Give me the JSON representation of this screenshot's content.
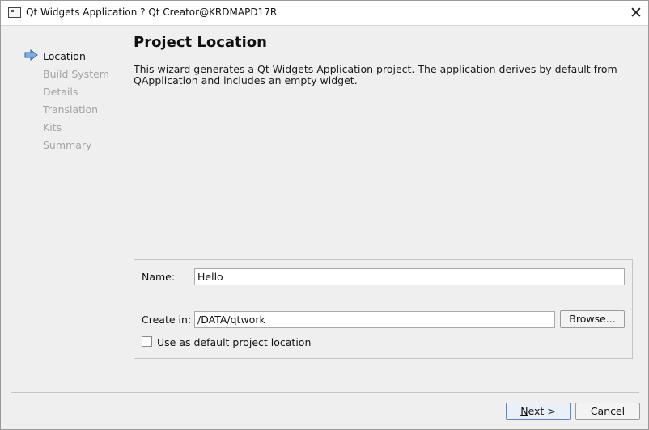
{
  "window": {
    "title": "Qt Widgets Application ? Qt Creator@KRDMAPD17R",
    "close_icon": "close-icon"
  },
  "sidebar": {
    "steps": [
      {
        "label": "Location",
        "active": true
      },
      {
        "label": "Build System",
        "active": false
      },
      {
        "label": "Details",
        "active": false
      },
      {
        "label": "Translation",
        "active": false
      },
      {
        "label": "Kits",
        "active": false
      },
      {
        "label": "Summary",
        "active": false
      }
    ],
    "active_marker_icon": "arrow-right-icon"
  },
  "page": {
    "title": "Project Location",
    "description": "This wizard generates a Qt Widgets Application project. The application derives by default from QApplication and includes an empty widget."
  },
  "form": {
    "name_label": "Name:",
    "name_value": "Hello",
    "create_in_label": "Create in:",
    "create_in_value": "/DATA/qtwork",
    "browse_label": "Browse...",
    "default_location_label": "Use as default project location",
    "default_location_checked": false
  },
  "footer": {
    "next_mnemonic": "N",
    "next_rest": "ext >",
    "cancel_label": "Cancel"
  },
  "colors": {
    "accent": "#5b87c5",
    "arrow_fill": "#7aaee8",
    "inactive_step": "#a3a3a3"
  }
}
